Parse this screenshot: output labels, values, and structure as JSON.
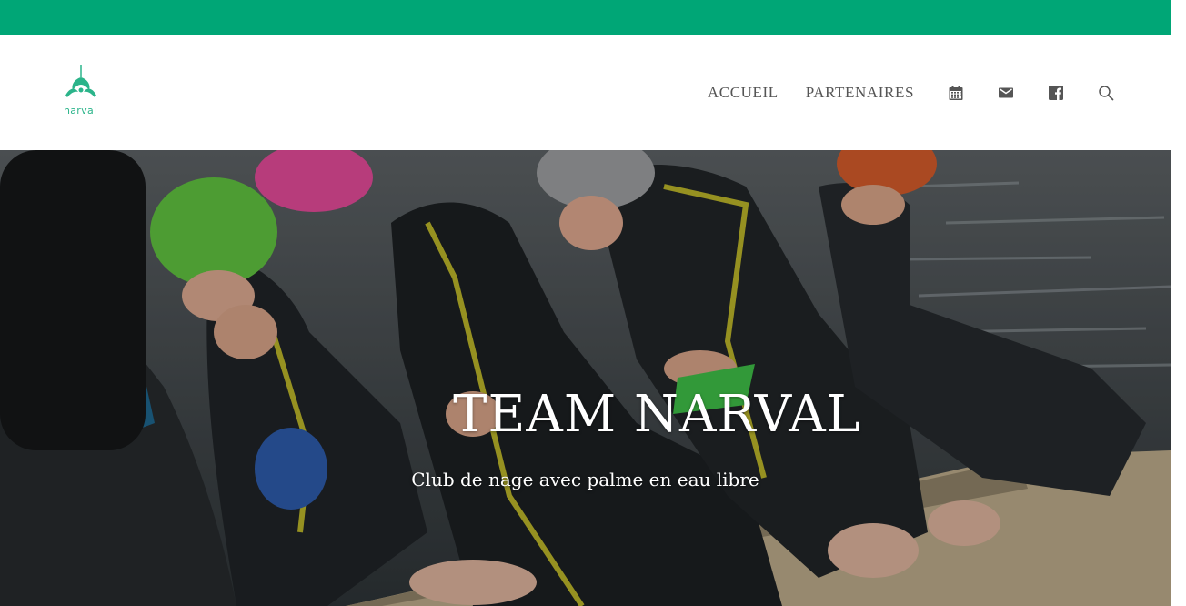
{
  "topbar": {
    "color": "#00a676"
  },
  "header": {
    "logo": {
      "text": "narval",
      "icon": "narwhal-logo-icon",
      "color": "#2bb48a"
    },
    "nav": {
      "items": [
        {
          "label": "ACCUEIL"
        },
        {
          "label": "PARTENAIRES"
        }
      ],
      "icons": [
        "calendar-icon",
        "mail-icon",
        "facebook-icon",
        "search-icon"
      ]
    }
  },
  "hero": {
    "title": "TEAM NARVAL",
    "subtitle": "Club de nage avec palme en eau libre"
  }
}
